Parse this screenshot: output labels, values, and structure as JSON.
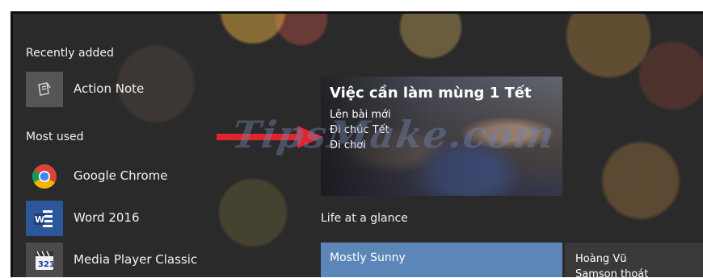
{
  "recently_added": {
    "label": "Recently added",
    "items": [
      {
        "label": "Action Note",
        "icon": "action-note-icon"
      }
    ]
  },
  "most_used": {
    "label": "Most used",
    "items": [
      {
        "label": "Google Chrome",
        "icon": "chrome-icon"
      },
      {
        "label": "Word 2016",
        "icon": "word-icon"
      },
      {
        "label": "Media Player Classic",
        "icon": "media-player-icon"
      }
    ]
  },
  "tiles": {
    "photo": {
      "title": "Việc cần làm mùng 1 Tết",
      "lines": [
        "Lên bài mới",
        "Đi chúc Tết",
        "Đi chơi"
      ]
    },
    "group_label": "Life at a glance",
    "weather": {
      "label": "Mostly Sunny",
      "color": "#5b86b7"
    },
    "person": {
      "lines": [
        "Hoàng Vũ",
        "Samson thoát"
      ]
    }
  },
  "watermark": "TipsMake.com",
  "colors": {
    "arrow": "#e0252d",
    "panel": "#2b2a2a",
    "tile_weather": "#5b86b7"
  }
}
